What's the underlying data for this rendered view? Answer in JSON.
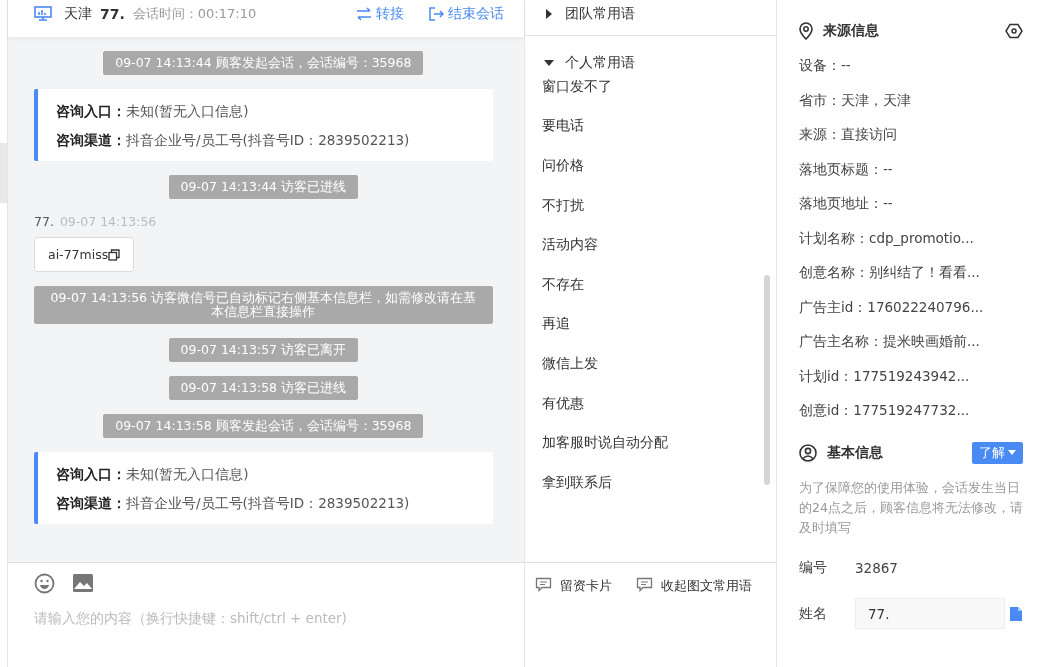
{
  "header": {
    "city": "天津",
    "visitor": "77.",
    "duration": "会话时间：00:17:10",
    "actions": [
      {
        "kind": "transfer",
        "label": "转接"
      },
      {
        "kind": "end",
        "label": "结束会话"
      }
    ]
  },
  "messages": [
    {
      "kind": "system",
      "text": "09-07 14:13:44 顾客发起会话，会话编号：35968"
    },
    {
      "kind": "info",
      "rows": [
        {
          "label": "咨询入口：",
          "value": "未知(暂无入口信息)"
        },
        {
          "label": "咨询渠道：",
          "value": "抖音企业号/员工号(抖音号ID：2839502213)"
        }
      ]
    },
    {
      "kind": "system",
      "text": "09-07 14:13:44 访客已进线"
    },
    {
      "kind": "visitor",
      "name": "77.",
      "time": "09-07 14:13:56",
      "text": "ai-77miss"
    },
    {
      "kind": "system",
      "text": "09-07 14:13:56 访客微信号已自动标记右侧基本信息栏，如需修改请在基本信息栏直接操作"
    },
    {
      "kind": "system",
      "text": "09-07 14:13:57 访客已离开"
    },
    {
      "kind": "system",
      "text": "09-07 14:13:58 访客已进线"
    },
    {
      "kind": "system",
      "text": "09-07 14:13:58 顾客发起会话，会话编号：35968"
    },
    {
      "kind": "info",
      "rows": [
        {
          "label": "咨询入口：",
          "value": "未知(暂无入口信息)"
        },
        {
          "label": "咨询渠道：",
          "value": "抖音企业号/员工号(抖音号ID：2839502213)"
        }
      ]
    }
  ],
  "input": {
    "placeholder": "请输入您的内容（换行快捷键：shift/ctrl + enter)"
  },
  "phrase_groups": [
    {
      "title": "团队常用语",
      "expanded": false
    },
    {
      "title": "个人常用语",
      "expanded": true,
      "items": [
        "窗口发不了",
        "要电话",
        "问价格",
        "不打扰",
        "活动内容",
        "不存在",
        "再追",
        "微信上发",
        "有优惠",
        "加客服时说自动分配",
        "拿到联系后"
      ]
    }
  ],
  "phrase_actions": [
    "留资卡片",
    "收起图文常用语"
  ],
  "source_info": {
    "title": "来源信息",
    "rows": [
      "设备：--",
      "省市：天津，天津",
      "来源：直接访问",
      "落地页标题：--",
      "落地页地址：--",
      "计划名称：cdp_promotio...",
      "创意名称：别纠结了！看看...",
      "广告主id：176022240796...",
      "广告主名称：提米映画婚前...",
      "计划id：177519243942...",
      "创意id：177519247732..."
    ]
  },
  "basic_info": {
    "title": "基本信息",
    "button": "了解",
    "note": "为了保障您的使用体验，会话发生当日的24点之后，顾客信息将无法修改，请及时填写",
    "fields": [
      {
        "kind": "text",
        "label": "编号",
        "value": "32867"
      },
      {
        "kind": "input",
        "label": "姓名",
        "value": "77."
      }
    ]
  }
}
